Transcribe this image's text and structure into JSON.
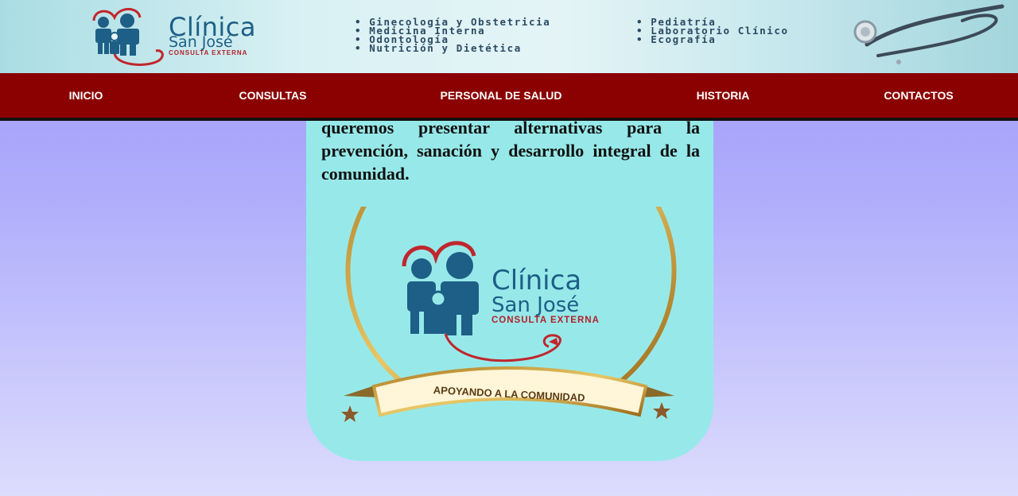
{
  "header": {
    "logo": {
      "title": "Clínica",
      "subtitle": "San José",
      "tagline": "CONSULTA EXTERNA"
    },
    "services_col1": [
      "Ginecología y Obstetricia",
      "Medicina Interna",
      "Odontología",
      "Nutrición y Dietética"
    ],
    "services_col2": [
      "Pediatría",
      "Laboratorio Clínico",
      "Ecografía"
    ]
  },
  "nav": {
    "items": [
      {
        "label": "INICIO"
      },
      {
        "label": "CONSULTAS"
      },
      {
        "label": "PERSONAL DE SALUD"
      },
      {
        "label": "HISTORIA"
      },
      {
        "label": "CONTACTOS"
      }
    ]
  },
  "content": {
    "intro_text": "queremos presentar alternativas para la prevención, sanación y desarrollo integral de la comunidad.",
    "emblem": {
      "title": "Clínica",
      "subtitle": "San José",
      "tagline": "CONSULTA EXTERNA",
      "ribbon": "APOYANDO A LA COMUNIDAD"
    }
  },
  "colors": {
    "nav_bg": "#8b0000",
    "card_bg": "#97e9e9",
    "brand_blue": "#1d5f86",
    "brand_red": "#b3202a",
    "gold": "#c9a03c"
  }
}
